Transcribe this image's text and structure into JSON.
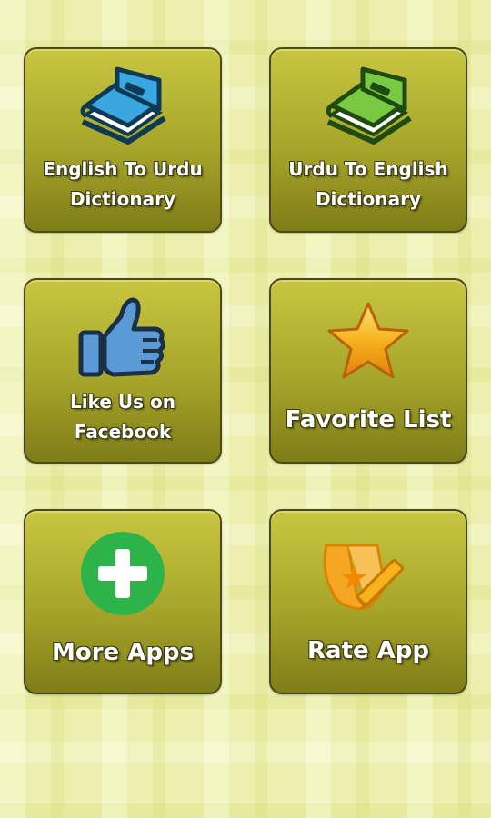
{
  "menu": {
    "eng_to_urdu": {
      "line1": "English To Urdu",
      "line2": "Dictionary",
      "icon": "blue-book-icon"
    },
    "urdu_to_eng": {
      "line1": "Urdu To English",
      "line2": "Dictionary",
      "icon": "green-book-icon"
    },
    "facebook": {
      "line1": "Like Us on",
      "line2": "Facebook",
      "icon": "thumbs-up-icon"
    },
    "favorites": {
      "label": "Favorite List",
      "icon": "star-icon"
    },
    "more_apps": {
      "label": "More Apps",
      "icon": "plus-circle-icon"
    },
    "rate_app": {
      "label": "Rate App",
      "icon": "rate-pencil-icon"
    }
  },
  "colors": {
    "background": "#ecefae",
    "tile_top": "#c8c640",
    "tile_bottom": "#7f7d17",
    "blue_book": "#3aa7e0",
    "green_book": "#7ac943",
    "star": "#f7b21d",
    "plus_circle": "#2cb34a"
  }
}
